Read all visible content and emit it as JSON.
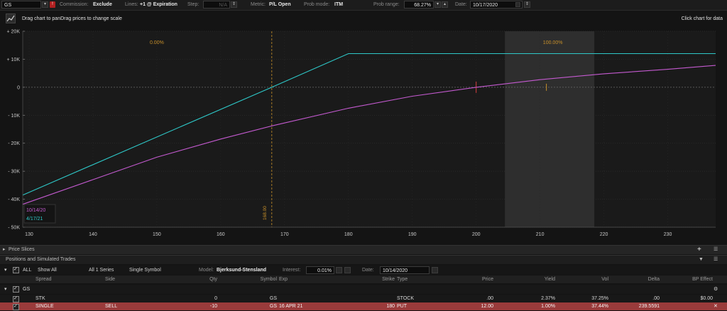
{
  "toolbar": {
    "symbol": "GS",
    "commission_label": "Commission:",
    "commission_value": "Exclude",
    "lines_label": "Lines:",
    "lines_value": "+1 @ Expiration",
    "step_label": "Step:",
    "step_value": "N/A",
    "metric_label": "Metric:",
    "metric_value": "P/L Open",
    "prob_mode_label": "Prob mode:",
    "prob_mode_value": "ITM",
    "prob_range_label": "Prob range:",
    "prob_range_value": "68.27%",
    "date_label": "Date:",
    "date_value": "10/17/2020"
  },
  "header": {
    "hint": "Drag chart to panDrag prices to change scale",
    "click_hint": "Click chart for data"
  },
  "chart_data": {
    "type": "line",
    "x_ticks": [
      130,
      140,
      150,
      160,
      170,
      180,
      190,
      200,
      210,
      220,
      230
    ],
    "y_ticks": [
      "+ 20K",
      "+ 10K",
      "0",
      "- 10K",
      "- 20K",
      "- 30K",
      "- 40K",
      "- 50K"
    ],
    "y_tick_values": [
      20000,
      10000,
      0,
      -10000,
      -20000,
      -30000,
      -40000,
      -50000
    ],
    "xlim": [
      129,
      237.5
    ],
    "ylim": [
      -50000,
      20000
    ],
    "series": [
      {
        "name": "4/17/21",
        "color": "#2ec8c8",
        "x": [
          129,
          168,
          180,
          237.5
        ],
        "y": [
          -38500,
          0,
          12000,
          12000
        ]
      },
      {
        "name": "10/14/20",
        "color": "#c45ad0",
        "x": [
          129,
          140,
          150,
          160,
          168,
          180,
          190,
          200,
          210,
          220,
          230,
          237.5
        ],
        "y": [
          -41800,
          -33000,
          -25000,
          -18500,
          -13800,
          -7500,
          -3200,
          0,
          2700,
          4800,
          6400,
          7800
        ]
      }
    ],
    "markers": [
      {
        "x": 168,
        "label": "168.00",
        "color": "#c8902a"
      },
      {
        "x": 200,
        "color": "#d84040"
      },
      {
        "x": 211,
        "color": "#c8902a"
      }
    ],
    "prob_band": {
      "x_from": 204.5,
      "x_to": 218.5
    },
    "annotations": [
      {
        "x": 150,
        "text": "0.00%"
      },
      {
        "x": 212,
        "text": "100.00%"
      }
    ],
    "legend": [
      "10/14/20",
      "4/17/21"
    ]
  },
  "price_slices": {
    "label": "Price Slices"
  },
  "positions": {
    "label": "Positions and Simulated Trades",
    "filter_all": "ALL",
    "show_all": "Show All",
    "series": "All 1 Series",
    "single_symbol": "Single Symbol",
    "model_label": "Model:",
    "model_value": "Bjerksund-Stensland",
    "interest_label": "Interest:",
    "interest_value": "0.01%",
    "date_label": "Date:",
    "date_value": "10/14/2020",
    "columns": [
      "Spread",
      "Side",
      "Qty",
      "Symbol",
      "Exp",
      "Strike",
      "Type",
      "Price",
      "Yield",
      "Vol",
      "Delta",
      "BP Effect"
    ],
    "group": "GS",
    "rows": [
      {
        "spread": "STK",
        "side": "",
        "qty": "0",
        "symbol": "GS",
        "exp": "",
        "strike": "",
        "type": "STOCK",
        "price": ".00",
        "yield": "2.37%",
        "vol": "37.25%",
        "delta": ".00",
        "bp": "$0.00"
      },
      {
        "spread": "SINGLE",
        "side": "SELL",
        "qty": "-10",
        "symbol": "GS",
        "exp": "16 APR 21",
        "strike": "180",
        "type": "PUT",
        "price": "12.00",
        "yield": "1.00%",
        "vol": "37.44%",
        "delta": "239.5591",
        "bp": ""
      }
    ]
  }
}
